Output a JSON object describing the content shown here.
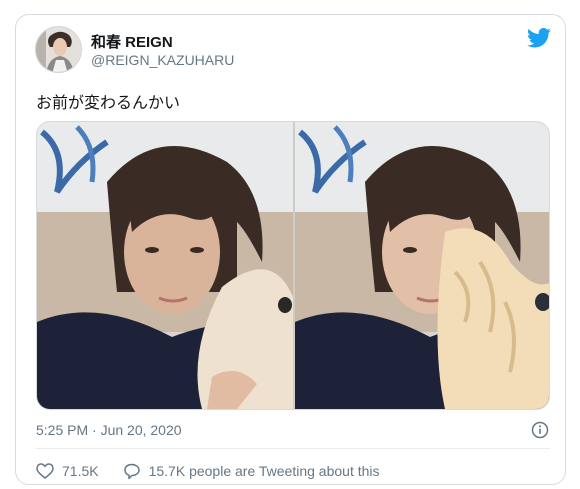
{
  "author": {
    "name": "和春 REIGN",
    "handle": "@REIGN_KAZUHARU"
  },
  "tweet": {
    "text": "お前が変わるんかい"
  },
  "meta": {
    "timestamp": "5:25 PM · Jun 20, 2020"
  },
  "actions": {
    "likes": "71.5K",
    "retweets_text": "15.7K people are Tweeting about this"
  },
  "colors": {
    "brand": "#1da1f2",
    "text": "#14171a",
    "muted": "#657786",
    "border": "#d5dbe0"
  },
  "icons": {
    "logo": "twitter-bird-icon",
    "info": "info-icon",
    "like": "heart-icon",
    "reply": "speech-bubble-icon"
  }
}
